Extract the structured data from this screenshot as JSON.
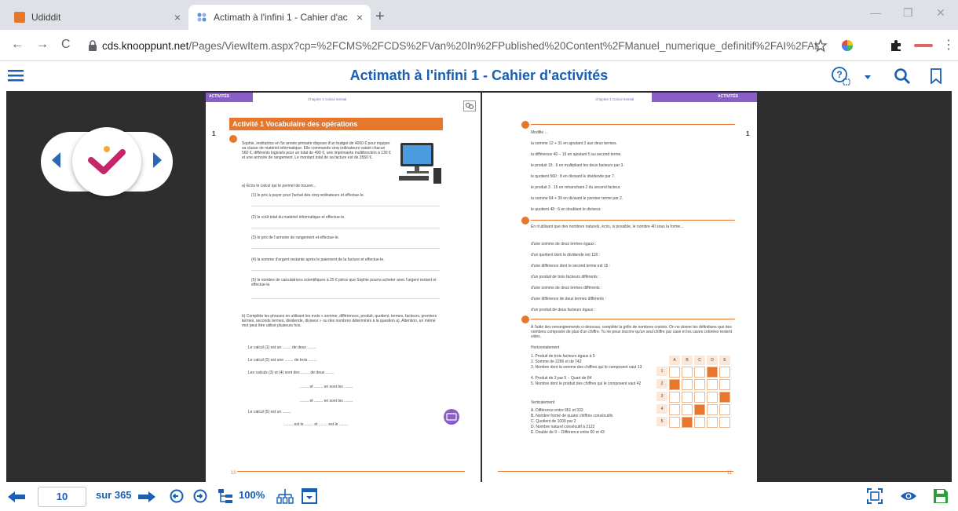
{
  "browser": {
    "tabs": [
      {
        "title": "Udiddit",
        "close": "×"
      },
      {
        "title": "Actimath à l'infini 1 - Cahier d'ac",
        "close": "×"
      }
    ],
    "new_tab": "+",
    "url_host": "cds.knooppunt.net",
    "url_path": "/Pages/ViewItem.aspx?cp=%2FCMS%2FCDS%2FVan%20In%2FPublished%20Content%2FManuel_numerique_definitif%2FAI%2FAI..."
  },
  "app": {
    "title": "Actimath à l'infini 1 - Cahier d'activités"
  },
  "left_page": {
    "header_label": "ACTIVITÉS",
    "chapter": "Chapitre 1 Calcul mental",
    "side_number": "1",
    "activity_title": "Activité 1 Vocabulaire des opérations",
    "intro": "Sophie, institutrice en 5e année primaire dispose d'un budget de 4000 € pour équiper sa classe de matériel informatique. Elle commande cinq ordinateurs valant chacun 560 €, différents logiciels pour un total de 490 €, une imprimante multifonction à 130 € et une armoire de rangement. Le montant total de sa facture est de 3550 €.",
    "q_a": "a) Écris le calcul qui te permet de trouver...",
    "items": [
      "(1) le prix à payer pour l'achat des cinq ordinateurs et effectue-le.",
      "(2) le coût total du matériel informatique et effectue-le.",
      "(3) le prix de l'armoire de rangement et effectue-le.",
      "(4) la somme d'argent restante après le paiement de la facture et effectue-le.",
      "(5) le nombre de calculatrices scientifiques à 25 € pièce que Sophie pourra acheter avec l'argent restant et effectue-le."
    ],
    "q_b": "b) Complète les phrases en utilisant les mots « somme, différences, produit, quotient, termes, facteurs, premiers termes, seconds termes, dividende, diviseur » ou des nombres déterminés à la question a). Attention, un même mot peut être utilisé plusieurs fois.",
    "fill": [
      "Le calcul (1) est un ........ de deux ........",
      "Le calcul (2) est une ........ de trois ........",
      "Les calculs (3) et (4) sont des ........ de deux ........",
      "........ et ........ en sont les ........",
      "........ et ........ en sont les ........",
      "Le calcul (5) est un ........",
      "........ est le ........ et ........ est le ........"
    ],
    "page_number": "10"
  },
  "right_page": {
    "header_label": "ACTIVITÉS",
    "chapter": "Chapitre 1 Calcul mental",
    "side_number": "1",
    "q2_title": "Modifie ...",
    "q2_items": [
      "la somme 12 + 31 en ajoutant 3 aux deux termes.",
      "la différence 46 − 15 en ajoutant 5 au second terme.",
      "le produit 15 . 6 en multipliant les deux facteurs par 3.",
      "le quotient 560 : 8 en divisant le dividende par 7.",
      "le produit 3 . 15 en retranchant 2 du second facteur.",
      "la somme 84 + 39 en divisant le premier terme par 2.",
      "le quotient 48 : 6 en doublant le diviseur."
    ],
    "q3_title": "En n'utilisant que des nombres naturels, écris, si possible, le nombre 40 sous la forme...",
    "q3_items": [
      "d'une somme de deux termes égaux :",
      "d'un quotient dont le dividende est 120 :",
      "d'une différence dont le second terme est 15 :",
      "d'un produit de trois facteurs différents :",
      "d'une somme de deux termes différents :",
      "d'une différence de deux termes différents :",
      "d'un produit de deux facteurs égaux :"
    ],
    "q4_title": "À l'aide des renseignements ci-dessous, complète la grille de nombres croisés. On ne donne les définitions que des nombres composés de plus d'un chiffre. Tu ne peux inscrire qu'un seul chiffre par case et les cases colorées restent vides.",
    "horizontal_label": "Horizontalement",
    "horizontal": [
      "1. Produit de trois facteurs égaux à 5",
      "2. Somme de 2286 et de 742",
      "3. Nombre dont la somme des chiffres qui le composent vaut 13",
      "4. Produit de 3 par 5 − Quart de 84",
      "5. Nombre dont le produit des chiffres qui le composent vaut 42"
    ],
    "vertical_label": "Verticalement",
    "vertical": [
      "A. Différence entre 951 et 332",
      "B. Nombre formé de quatre chiffres consécutifs",
      "C. Quotient de 1000 par 2",
      "D. Nombre naturel consécutif à 2122",
      "E. Double de 9 − Différence entre 60 et 43"
    ],
    "grid_cols": [
      "A",
      "B",
      "C",
      "D",
      "E"
    ],
    "grid_rows": [
      "1",
      "2",
      "3",
      "4",
      "5"
    ],
    "page_number": "11"
  },
  "toolbar": {
    "current_page": "10",
    "page_total": "sur 365",
    "zoom": "100%"
  },
  "colors": {
    "accent": "#1a5fb4",
    "orange": "#e8772e",
    "purple": "#8a5ec7"
  }
}
